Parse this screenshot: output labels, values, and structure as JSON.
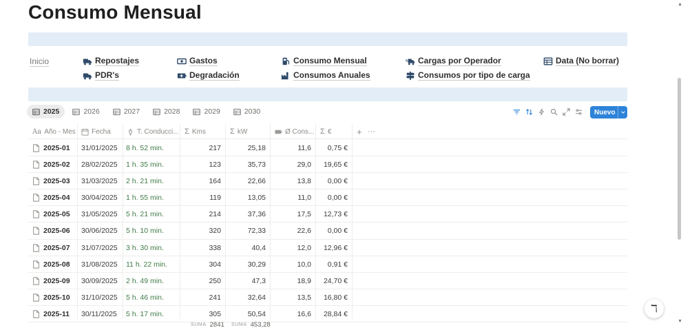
{
  "page": {
    "title": "Consumo Mensual"
  },
  "nav": {
    "home": "Inicio",
    "links": [
      {
        "label": "Repostajes",
        "icon": "truck-icon"
      },
      {
        "label": "PDR's",
        "icon": "truck-icon"
      },
      {
        "label": "Gastos",
        "icon": "money-icon"
      },
      {
        "label": "Degradación",
        "icon": "battery-icon"
      },
      {
        "label": "Consumo Mensual",
        "icon": "fuel-pump-icon"
      },
      {
        "label": "Consumos Anuales",
        "icon": "factory-icon"
      },
      {
        "label": "Cargas por Operador",
        "icon": "truck-fast-icon"
      },
      {
        "label": "Consumos por tipo de carga",
        "icon": "signpost-icon"
      },
      {
        "label": "Data (No borrar)",
        "icon": "table-icon"
      }
    ]
  },
  "tabs": [
    {
      "label": "2025",
      "active": true
    },
    {
      "label": "2026"
    },
    {
      "label": "2027"
    },
    {
      "label": "2028"
    },
    {
      "label": "2029"
    },
    {
      "label": "2030"
    }
  ],
  "toolbar": {
    "new_label": "Nuevo"
  },
  "columns": {
    "name": "Año - Mes",
    "date": "Fecha",
    "time": "T. Conducci...",
    "kms": "Kms",
    "kw": "kW",
    "cons": "Ø Cons...",
    "eur": "€"
  },
  "rows": [
    {
      "name": "2025-01",
      "date": "31/01/2025",
      "time": "8 h. 52 min.",
      "kms": "217",
      "kw": "25,18",
      "cons": "11,6",
      "eur": "0,75 €"
    },
    {
      "name": "2025-02",
      "date": "28/02/2025",
      "time": "1 h. 35 min.",
      "kms": "123",
      "kw": "35,73",
      "cons": "29,0",
      "eur": "19,65 €"
    },
    {
      "name": "2025-03",
      "date": "31/03/2025",
      "time": "2 h. 21 min.",
      "kms": "164",
      "kw": "22,66",
      "cons": "13,8",
      "eur": "0,00 €"
    },
    {
      "name": "2025-04",
      "date": "30/04/2025",
      "time": "1 h. 55 min.",
      "kms": "119",
      "kw": "13,05",
      "cons": "11,0",
      "eur": "0,00 €"
    },
    {
      "name": "2025-05",
      "date": "31/05/2025",
      "time": "5 h. 21 min.",
      "kms": "214",
      "kw": "37,36",
      "cons": "17,5",
      "eur": "12,73 €"
    },
    {
      "name": "2025-06",
      "date": "30/06/2025",
      "time": "5 h. 10 min.",
      "kms": "320",
      "kw": "72,33",
      "cons": "22,6",
      "eur": "0,00 €"
    },
    {
      "name": "2025-07",
      "date": "31/07/2025",
      "time": "3 h. 30 min.",
      "kms": "338",
      "kw": "40,4",
      "cons": "12,0",
      "eur": "12,96 €"
    },
    {
      "name": "2025-08",
      "date": "31/08/2025",
      "time": "11 h. 22 min.",
      "kms": "304",
      "kw": "30,29",
      "cons": "10,0",
      "eur": "0,91 €"
    },
    {
      "name": "2025-09",
      "date": "30/09/2025",
      "time": "2 h. 49 min.",
      "kms": "250",
      "kw": "47,3",
      "cons": "18,9",
      "eur": "24,70 €"
    },
    {
      "name": "2025-10",
      "date": "31/10/2025",
      "time": "5 h. 46 min.",
      "kms": "241",
      "kw": "32,64",
      "cons": "13,5",
      "eur": "16,80 €"
    },
    {
      "name": "2025-11",
      "date": "30/11/2025",
      "time": "5 h. 17 min.",
      "kms": "305",
      "kw": "50,54",
      "cons": "16,6",
      "eur": "28,84 €"
    }
  ],
  "sums": {
    "label": "SUMA",
    "kms": "2841",
    "kw": "453,28"
  },
  "help": {
    "glyph": "ℸ"
  }
}
